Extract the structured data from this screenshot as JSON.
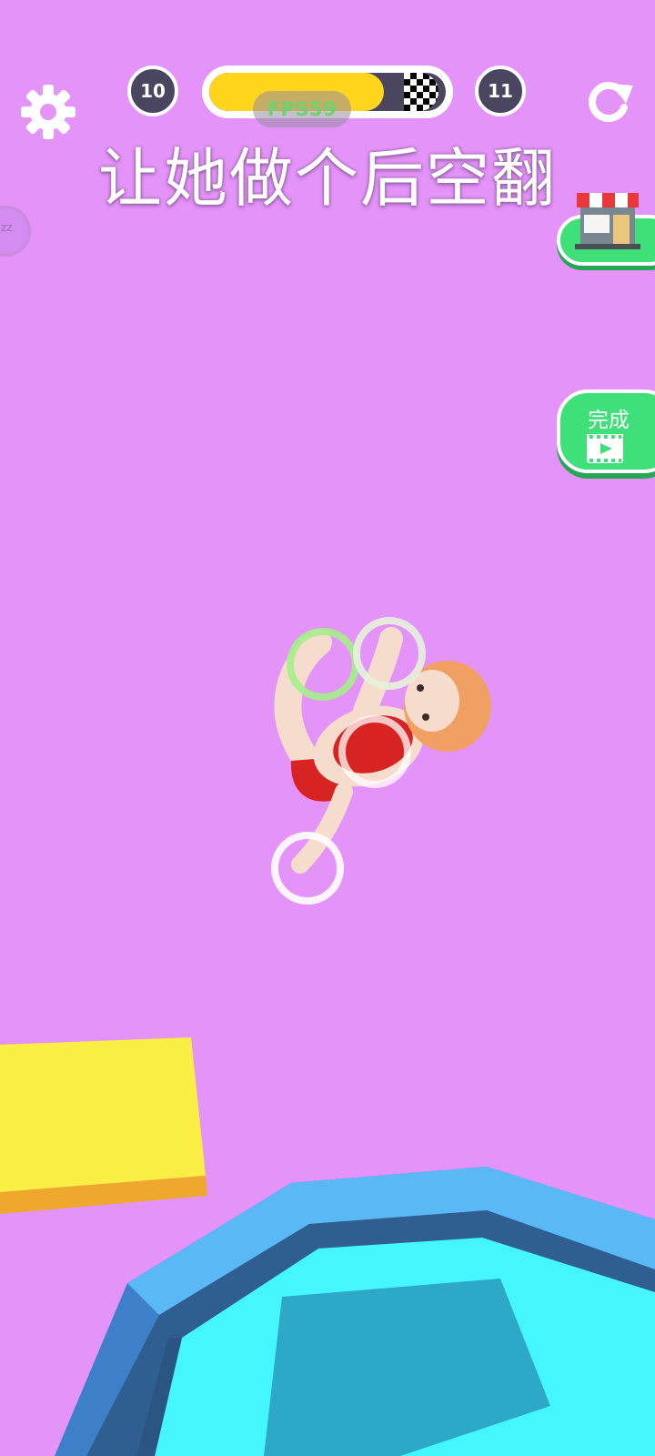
{
  "hud": {
    "current_level": "10",
    "next_level": "11",
    "progress": 0.74,
    "fps_label": "FPS59"
  },
  "instruction": "让她做个后空翻",
  "buttons": {
    "done_label": "完成"
  },
  "colors": {
    "background": "#e493f8",
    "progress_fill": "#ffd51e",
    "button_green": "#3fe07a",
    "badge_dark": "#4a4660",
    "platform_yellow": "#fbef45",
    "pool_water": "#45f6ff",
    "pool_rim": "#5ab8f5",
    "target_ring_active": "#a4f08a",
    "target_ring": "#ffffff"
  },
  "icons": {
    "settings": "gear-icon",
    "restart": "restart-icon",
    "shop": "shop-icon",
    "video": "video-icon",
    "sleep": "snooze-icon"
  }
}
